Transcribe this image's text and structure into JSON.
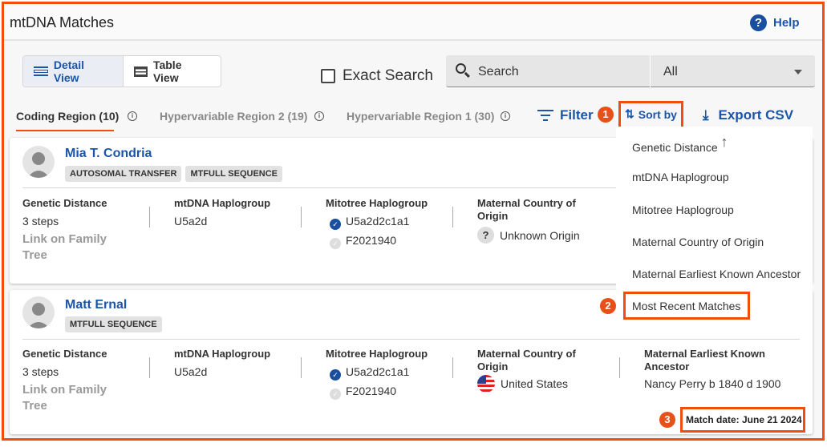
{
  "header": {
    "title": "mtDNA Matches",
    "help": "Help"
  },
  "toolbar": {
    "detail_view": "Detail View",
    "table_view": "Table View",
    "exact_search": "Exact Search",
    "search_placeholder": "Search",
    "scope": "All"
  },
  "tabs": [
    {
      "label": "Coding Region (10)",
      "active": true
    },
    {
      "label": "Hypervariable Region 2 (19)"
    },
    {
      "label": "Hypervariable Region 1 (30)"
    }
  ],
  "actions": {
    "filter": "Filter",
    "sort_by": "Sort by",
    "export": "Export CSV"
  },
  "sort_menu": {
    "items": [
      "Genetic Distance",
      "mtDNA Haplogroup",
      "Mitotree Haplogroup",
      "Maternal Country of Origin",
      "Maternal Earliest Known Ancestor",
      "Most Recent Matches"
    ],
    "sort_direction_icon": "arrow-up-icon"
  },
  "annotations": [
    "1",
    "2",
    "3"
  ],
  "labels": {
    "genetic_distance": "Genetic Distance",
    "mtdna": "mtDNA Haplogroup",
    "mitotree": "Mitotree Haplogroup",
    "country": "Maternal Country of Origin",
    "ancestor": "Maternal Earliest Known Ancestor",
    "link_tree": "Link on Family Tree"
  },
  "matches": [
    {
      "name": "Mia T. Condria",
      "tags": [
        "AUTOSOMAL TRANSFER",
        "MTFULL SEQUENCE"
      ],
      "distance": "3 steps",
      "mtdna": "U5a2d",
      "mitotree": [
        "U5a2d2c1a1",
        "F2021940"
      ],
      "country": "Unknown Origin"
    },
    {
      "name": "Matt Ernal",
      "tags": [
        "MTFULL SEQUENCE"
      ],
      "distance": "3 steps",
      "mtdna": "U5a2d",
      "mitotree": [
        "U5a2d2c1a1",
        "F2021940"
      ],
      "country": "United States",
      "ancestor": "Nancy Perry b 1840 d 1900",
      "match_date": "Match date: June 21 2024"
    }
  ],
  "colors": {
    "accent": "#1a55a8",
    "highlight": "#f04e0f"
  }
}
